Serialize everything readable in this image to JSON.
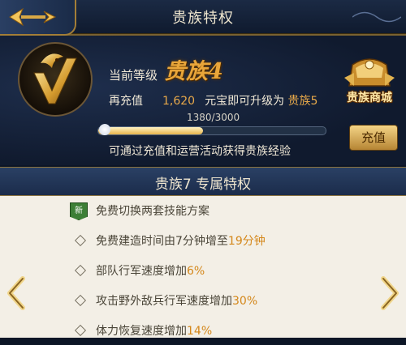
{
  "header": {
    "title": "贵族特权"
  },
  "status": {
    "current_level_label": "当前等级",
    "level_name": "贵族4",
    "recharge_prefix": "再充值",
    "recharge_amount": "1,620",
    "recharge_suffix": "元宝即可升级为",
    "next_level": "贵族5",
    "progress_text": "1380/3000",
    "progress_fraction": 0.46,
    "hint": "可通过充值和运营活动获得贵族经验",
    "shop_label": "贵族商城",
    "recharge_button": "充值"
  },
  "privileges": {
    "section_title": "贵族7  专属特权",
    "new_badge": "新",
    "items": [
      {
        "is_new": true,
        "text": "免费切换两套技能方案",
        "highlight": "",
        "rest": ""
      },
      {
        "is_new": false,
        "text": "免费建造时间由7分钟增至",
        "highlight": "19分钟",
        "rest": ""
      },
      {
        "is_new": false,
        "text": "部队行军速度增加",
        "highlight": "6%",
        "rest": ""
      },
      {
        "is_new": false,
        "text": "攻击野外敌兵行军速度增加",
        "highlight": "30%",
        "rest": ""
      },
      {
        "is_new": false,
        "text": "体力恢复速度增加",
        "highlight": "14%",
        "rest": ""
      }
    ]
  },
  "icons": {
    "back": "back-arrow-icon",
    "badge": "dragon-emblem-icon",
    "shop": "treasure-chest-icon",
    "prev": "chevron-left-icon",
    "next": "chevron-right-icon"
  },
  "colors": {
    "accent_gold": "#e9a63a",
    "highlight_orange": "#d4871a",
    "panel_dark": "#101a2e",
    "panel_light": "#f3efe6"
  }
}
